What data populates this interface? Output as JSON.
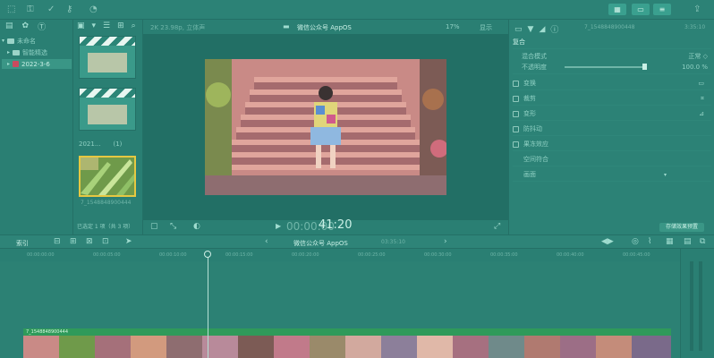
{
  "viewer": {
    "format": "2K 23.98p, 立体声",
    "project": "微信公众号 AppOS",
    "zoom": "17%",
    "display": "显示",
    "timecode_prefix": "00:00:00",
    "timecode": "41:20"
  },
  "library": {
    "root": "未命名",
    "items": [
      {
        "label": "智能精选"
      },
      {
        "label": "2022-3-6"
      }
    ]
  },
  "browser": {
    "group_label": "2021...",
    "group_count": "(1)",
    "thumb_caption": "7_1548848900444",
    "selection_status": "已选定 1 项（共 3 项）"
  },
  "inspector": {
    "clip_id": "7_1548848900448",
    "duration": "3:35:10",
    "section_title": "复合",
    "blend_mode_label": "混合模式",
    "blend_mode_value": "正常 ◇",
    "opacity_label": "不透明度",
    "opacity_value": "100.0 %",
    "rows": [
      {
        "label": "变换"
      },
      {
        "label": "裁剪"
      },
      {
        "label": "变形"
      },
      {
        "label": "防抖动"
      },
      {
        "label": "果冻效应"
      },
      {
        "label": "空间符合"
      },
      {
        "label": "画面"
      }
    ],
    "save_preset": "存储效果预置"
  },
  "timeline": {
    "index_label": "索引",
    "title": "微信公众号 AppOS",
    "duration": "03:35:10",
    "clip_label": "7_1548848900444",
    "ticks": [
      "00:00:00:00",
      "00:00:05:00",
      "00:00:10:00",
      "00:00:15:00",
      "00:00:20:00",
      "00:00:25:00",
      "00:00:30:00",
      "00:00:35:00",
      "00:00:40:00",
      "00:00:45:00"
    ]
  },
  "colors": {
    "accent_green": "#3aa08f",
    "clip_green": "#2f9a5a",
    "selection_red": "#c94b5e"
  }
}
